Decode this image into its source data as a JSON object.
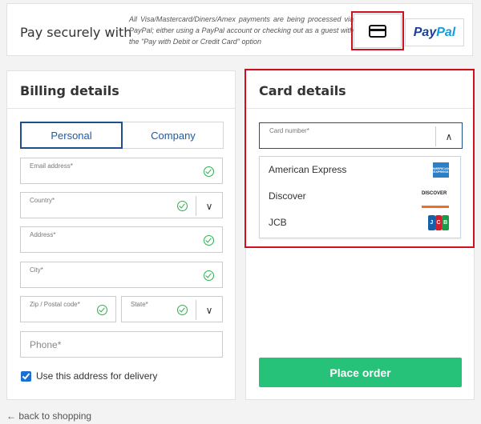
{
  "payment": {
    "title": "Pay securely with",
    "note": "All Visa/Mastercard/Diners/Amex payments are being processed via PayPal; either using a PayPal account or checking out as a guest with the \"Pay with Debit or Credit Card\" option",
    "paypal_logo": {
      "part1": "Pay",
      "part2": "Pal"
    }
  },
  "billing": {
    "title": "Billing details",
    "tabs": [
      {
        "label": "Personal",
        "active": true
      },
      {
        "label": "Company",
        "active": false
      }
    ],
    "fields": {
      "email": {
        "label": "Email address*"
      },
      "country": {
        "label": "Country*"
      },
      "address": {
        "label": "Address*"
      },
      "city": {
        "label": "City*"
      },
      "zip": {
        "label": "Zip / Postal code*"
      },
      "state": {
        "label": "State*"
      },
      "phone": {
        "placeholder": "Phone*"
      }
    },
    "delivery_checkbox": {
      "label": "Use this address for delivery",
      "checked": true
    }
  },
  "card": {
    "title": "Card details",
    "card_number_label": "Card number*",
    "options": [
      {
        "name": "American Express",
        "logo": "amex-logo",
        "logo_text": "AMERICAN EXPRESS"
      },
      {
        "name": "Discover",
        "logo": "discover-logo",
        "logo_text": "DISCOVER"
      },
      {
        "name": "JCB",
        "logo": "jcb-logo",
        "logo_text": [
          "J",
          "C",
          "B"
        ]
      }
    ]
  },
  "place_order": "Place order",
  "back_link": "back to shopping",
  "colors": {
    "accent": "#1c4f90",
    "highlight": "#d01020",
    "success": "#2fae4e",
    "place_order": "#26c27a"
  }
}
